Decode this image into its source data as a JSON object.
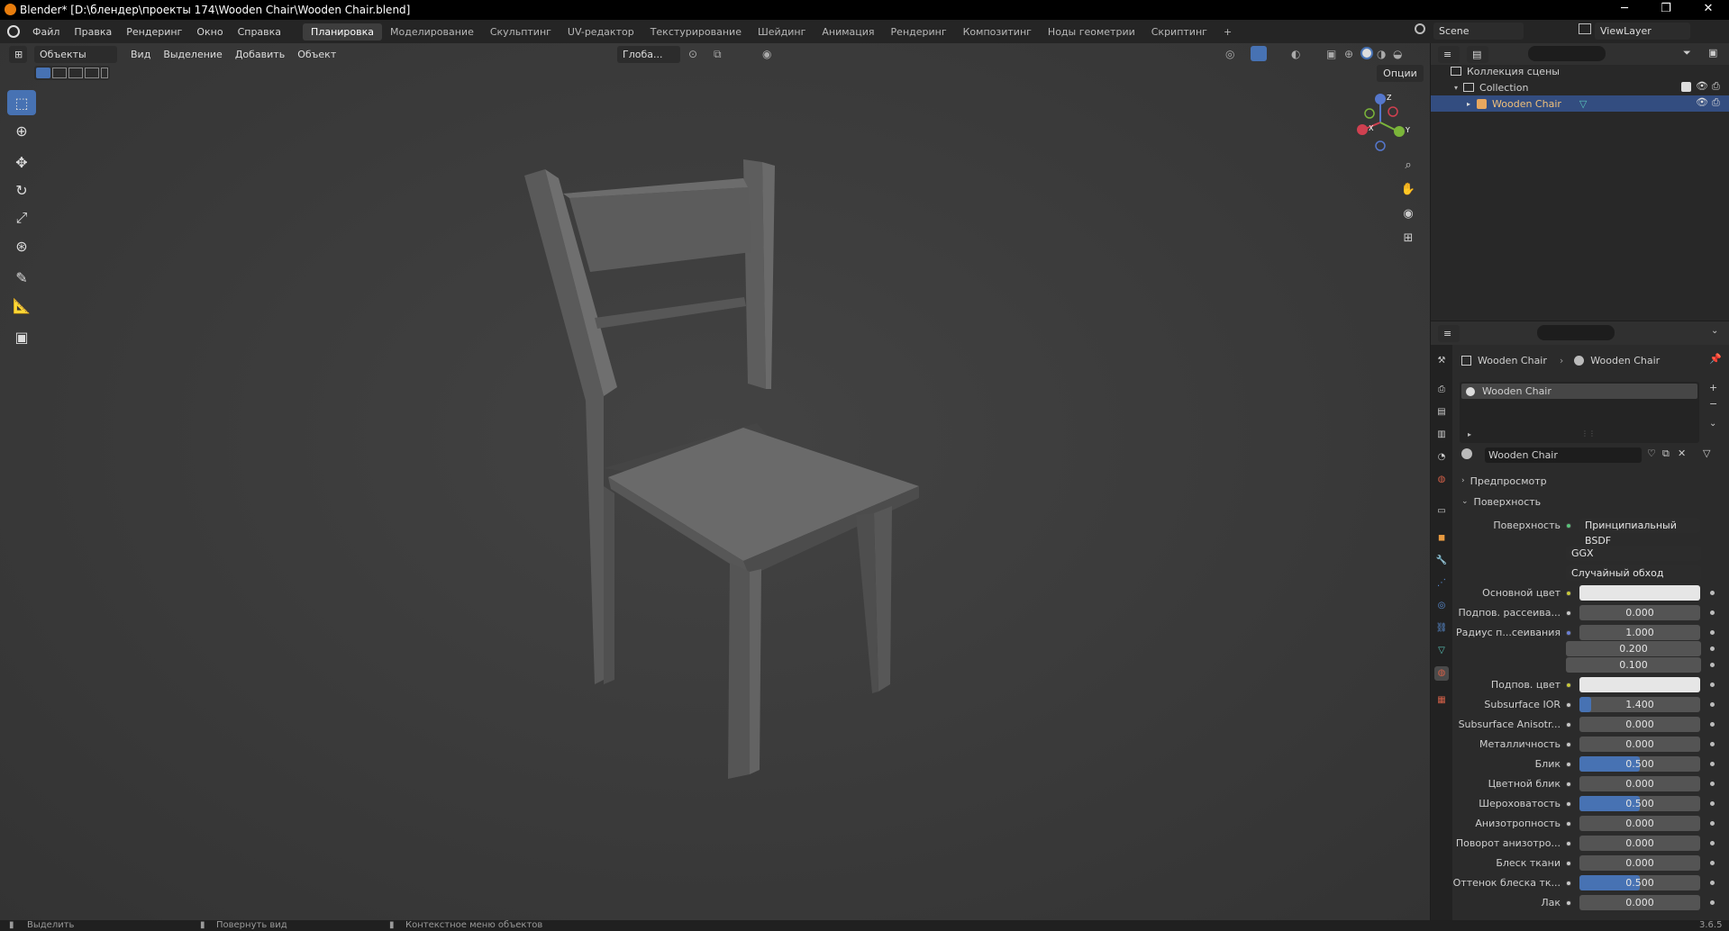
{
  "window": {
    "title": "Blender* [D:\\блендер\\проекты 174\\Wooden Chair\\Wooden Chair.blend]",
    "minimize": "─",
    "maximize": "❐",
    "close": "✕"
  },
  "menu": [
    "Файл",
    "Правка",
    "Рендеринг",
    "Окно",
    "Справка"
  ],
  "workspaces": [
    {
      "label": "Планировка",
      "active": true
    },
    {
      "label": "Моделирование"
    },
    {
      "label": "Скульптинг"
    },
    {
      "label": "UV-редактор"
    },
    {
      "label": "Текстурирование"
    },
    {
      "label": "Шейдинг"
    },
    {
      "label": "Анимация"
    },
    {
      "label": "Рендеринг"
    },
    {
      "label": "Композитинг"
    },
    {
      "label": "Ноды геометрии"
    },
    {
      "label": "Скриптинг"
    }
  ],
  "add_workspace": "+",
  "scene": {
    "name": "Scene",
    "viewlayer": "ViewLayer"
  },
  "viewport": {
    "mode": "Объекты",
    "menus": [
      "Вид",
      "Выделение",
      "Добавить",
      "Объект"
    ],
    "transform_orientation": "Глоба...",
    "options": "Опции",
    "gizmo": {
      "x": "X",
      "y": "Y",
      "z": "Z"
    }
  },
  "outliner": {
    "scene_collection": "Коллекция сцены",
    "collection": "Collection",
    "object": "Wooden Chair"
  },
  "properties": {
    "breadcrumb_object": "Wooden Chair",
    "breadcrumb_material": "Wooden Chair",
    "slot": "Wooden Chair",
    "material_name": "Wooden Chair",
    "panel_preview": "Предпросмотр",
    "panel_surface": "Поверхность",
    "surface_label": "Поверхность",
    "surface_value": "Принципиальный BSDF",
    "distribution": "GGX",
    "subsurface_method": "Случайный обход",
    "rows": [
      {
        "label": "Основной цвет",
        "type": "color",
        "dot": "yel"
      },
      {
        "label": "Подпов. рассеива...",
        "value": "0.000",
        "fill": 0
      },
      {
        "label": "Радиус п...сеивания",
        "value": "1.000",
        "fill": 0,
        "dot": "blu"
      },
      {
        "label": "",
        "value": "0.200",
        "fill": 0,
        "nodot": true
      },
      {
        "label": "",
        "value": "0.100",
        "fill": 0,
        "nodot": true
      },
      {
        "label": "Подпов. цвет",
        "type": "color",
        "dot": "yel"
      },
      {
        "label": "Subsurface IOR",
        "value": "1.400",
        "fill": 0.1
      },
      {
        "label": "Subsurface Anisotr...",
        "value": "0.000",
        "fill": 0
      },
      {
        "label": "Металличность",
        "value": "0.000",
        "fill": 0
      },
      {
        "label": "Блик",
        "value": "0.500",
        "fill": 0.5
      },
      {
        "label": "Цветной блик",
        "value": "0.000",
        "fill": 0
      },
      {
        "label": "Шероховатость",
        "value": "0.500",
        "fill": 0.5
      },
      {
        "label": "Анизотропность",
        "value": "0.000",
        "fill": 0
      },
      {
        "label": "Поворот анизотро...",
        "value": "0.000",
        "fill": 0
      },
      {
        "label": "Блеск ткани",
        "value": "0.000",
        "fill": 0
      },
      {
        "label": "Оттенок блеска тк...",
        "value": "0.500",
        "fill": 0.5
      },
      {
        "label": "Лак",
        "value": "0.000",
        "fill": 0
      }
    ]
  },
  "status": {
    "select": "Выделить",
    "rotate": "Повернуть вид",
    "context": "Контекстное меню объектов",
    "version": "3.6.5"
  },
  "colors": {
    "accent": "#4772b3",
    "selection": "#334d80",
    "logo": "#e87d0d"
  }
}
